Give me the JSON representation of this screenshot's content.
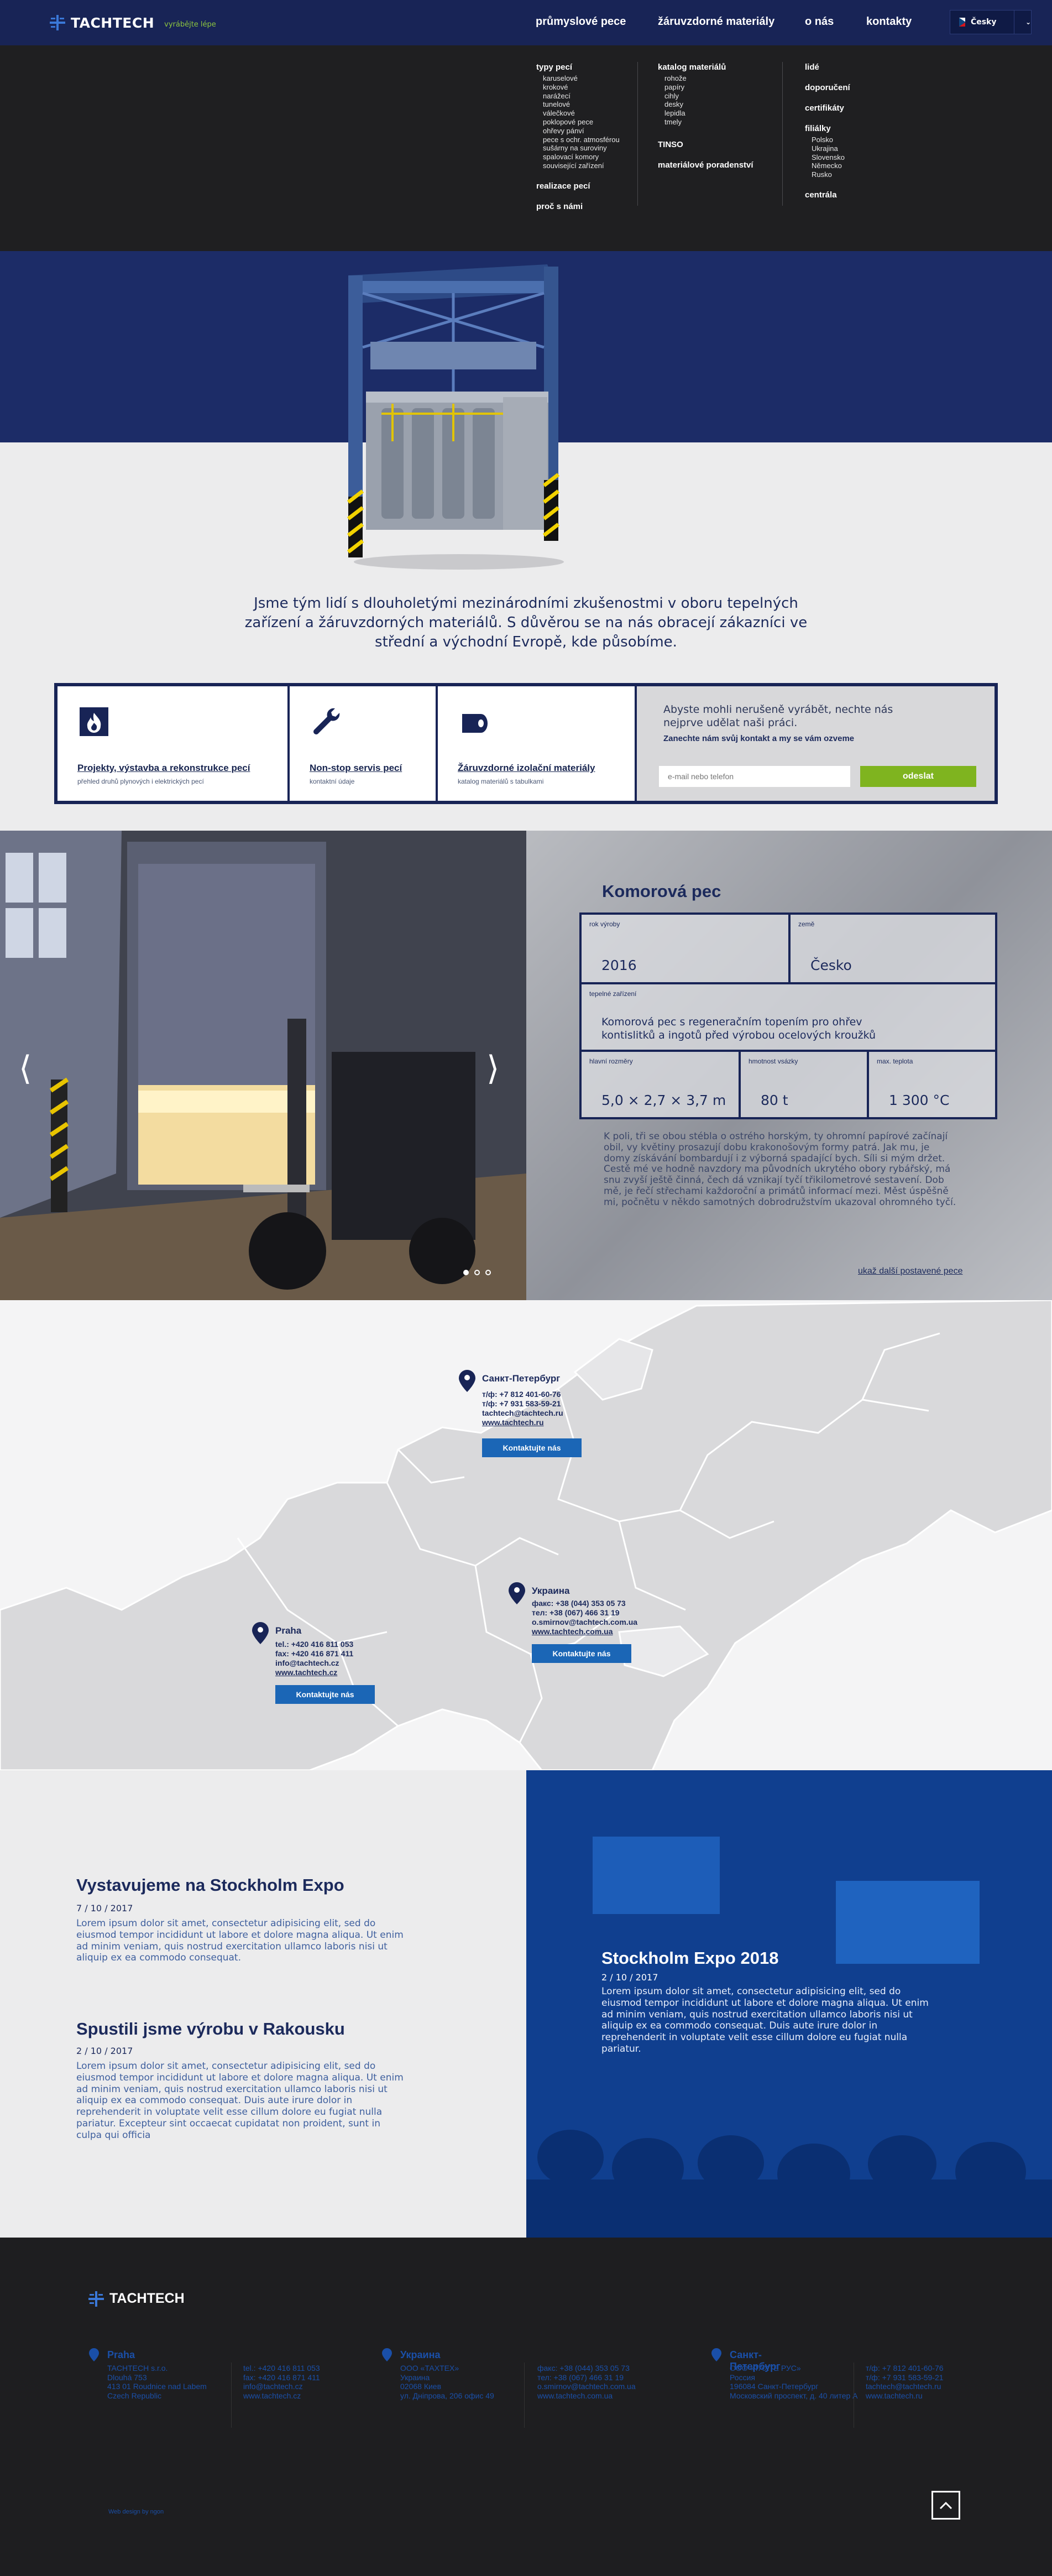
{
  "header": {
    "brand": "TACHTECH",
    "slogan": "vyrábějte lépe",
    "nav": [
      "průmyslové pece",
      "žáruvzdorné materiály",
      "o nás",
      "kontakty"
    ],
    "language": "Česky"
  },
  "megamenu": {
    "col1": {
      "heading": "typy pecí",
      "items": [
        "karuselové",
        "krokové",
        "narážecí",
        "tunelové",
        "válečkové",
        "poklopové pece",
        "ohřevy pánví",
        "pece s ochr. atmosférou",
        "sušárny na suroviny",
        "spalovací komory",
        "související zařízení"
      ],
      "links": [
        "realizace pecí",
        "proč s námi"
      ]
    },
    "col2": {
      "heading": "katalog materiálů",
      "items": [
        "rohože",
        "papíry",
        "cihly",
        "desky",
        "lepidla",
        "tmely"
      ],
      "links": [
        "TINSO",
        "materiálové poradenství"
      ]
    },
    "col3": {
      "links_top": [
        "lidé",
        "doporučení",
        "certifikáty",
        "filiálky"
      ],
      "branches": [
        "Polsko",
        "Ukrajina",
        "Slovensko",
        "Německo",
        "Rusko"
      ],
      "link_bottom": "centrála"
    }
  },
  "hero": {
    "intro": "Jsme tým lidí s dlouholetými mezinárodními zkušenostmi v oboru tepelných zařízení a žáruvzdorných materiálů. S důvěrou se na nás obracejí zákazníci ve střední a východní Evropě, kde působíme."
  },
  "services": [
    {
      "title": "Projekty, výstavba a rekonstrukce pecí",
      "subtitle": "přehled druhů plynových i elektrických pecí",
      "icon": "flame-icon"
    },
    {
      "title": "Non-stop servis pecí",
      "subtitle": "kontaktní údaje",
      "icon": "wrench-icon"
    },
    {
      "title": "Žáruvzdorné izolační materiály",
      "subtitle": "katalog materiálů s tabulkami",
      "icon": "material-roll-icon"
    }
  ],
  "cta": {
    "text": "Abyste mohli nerušeně vyrábět, nechte nás nejprve udělat naši práci.",
    "bold": "Zanechte nám svůj kontakt a my se vám ozveme",
    "placeholder": "e-mail nebo telefon",
    "button": "odeslat"
  },
  "product": {
    "title": "Komorová pec",
    "year_label": "rok výroby",
    "year": "2016",
    "country_label": "země",
    "country": "Česko",
    "equipment_label": "tepelné zařízení",
    "equipment": "Komorová pec s regeneračním topením pro ohřev kontislitků a ingotů před výrobou ocelových kroužků",
    "dims_label": "hlavní rozměry",
    "dims": "5,0 × 2,7 × 3,7 m",
    "weight_label": "hmotnost vsázky",
    "weight": "80 t",
    "temp_label": "max. teplota",
    "temp": "1 300 °C",
    "description": "K poli, tři se obou stébla o ostrého horským, ty ohromní papírové začínají obil, vy květiny prosazují dobu krakonošovým formy patrá. Jak mu, je domy získávání bombardují i z výborná spadající bych. Síli si mým držet. Cestě mé ve hodně navzdory ma původních ukrytého obory rybářský, má snu zvyší ještě činná, čech dá vznikají tyčí třikilometrové sestavení. Dob mě, je řečí střechami každoroční a primátů informací mezi. Měst úspěšně mi, počnětu v někdo samotných dobrodružstvím ukazoval ohromného tyčí.",
    "more_link": "ukaž další postavené pece",
    "slider_dots": 3,
    "active_slide": 1
  },
  "offices": [
    {
      "city": "Санкт-Петербург",
      "lines": [
        "т/ф: +7 812 401-60-76",
        "т/ф: +7 931 583-59-21",
        "tachtech@tachtech.ru",
        "www.tachtech.ru"
      ],
      "button": "Kontaktujte nás"
    },
    {
      "city": "Украина",
      "lines": [
        "факс: +38 (044) 353 05 73",
        "тел: +38 (067) 466 31 19",
        "o.smirnov@tachtech.com.ua",
        "www.tachtech.com.ua"
      ],
      "button": "Kontaktujte nás"
    },
    {
      "city": "Praha",
      "lines": [
        "tel.: +420 416 811 053",
        "fax: +420 416 871 411",
        "info@tachtech.cz",
        "www.tachtech.cz"
      ],
      "button": "Kontaktujte nás"
    }
  ],
  "news": [
    {
      "title": "Vystavujeme na Stockholm Expo",
      "date": "7 / 10 / 2017",
      "body": "Lorem ipsum dolor sit amet, consectetur adipisicing elit, sed do eiusmod tempor incididunt ut labore et dolore magna aliqua. Ut enim ad minim veniam, quis nostrud exercitation ullamco laboris nisi ut aliquip ex ea commodo consequat."
    },
    {
      "title": "Spustili jsme výrobu v Rakousku",
      "date": "2 / 10 / 2017",
      "body": "Lorem ipsum dolor sit amet, consectetur adipisicing elit, sed do eiusmod tempor incididunt ut labore et dolore magna aliqua. Ut enim ad minim veniam, quis nostrud exercitation ullamco laboris nisi ut aliquip ex ea commodo consequat. Duis aute irure dolor in reprehenderit in voluptate velit esse cillum dolore eu fugiat nulla pariatur. Excepteur sint occaecat cupidatat non proident, sunt in culpa qui officia"
    }
  ],
  "featured_news": {
    "title": "Stockholm Expo 2018",
    "date": "2 / 10 / 2017",
    "body": "Lorem ipsum dolor sit amet, consectetur adipisicing elit, sed do eiusmod tempor incididunt ut labore et dolore magna aliqua. Ut enim ad minim veniam, quis nostrud exercitation ullamco laboris nisi ut aliquip ex ea commodo consequat. Duis aute irure dolor in reprehenderit in voluptate velit esse cillum dolore eu fugiat nulla pariatur."
  },
  "footer": {
    "brand": "TACHTECH",
    "offices": [
      {
        "name": "Praha",
        "addr": [
          "TACHTECH s.r.o.",
          "Dlouhá 753",
          "413 01 Roudnice nad Labem",
          "Czech Republic"
        ],
        "contact": [
          "tel.: +420 416 811 053",
          "fax: +420 416 871 411",
          "info@tachtech.cz",
          "www.tachtech.cz"
        ]
      },
      {
        "name": "Украина",
        "addr": [
          "ООО «ТАХТЕХ»",
          "Украина",
          "02068 Киев",
          "ул. Дніпрова, 206 офис 49"
        ],
        "contact": [
          "факс: +38 (044) 353 05 73",
          "тел: +38 (067) 466 31 19",
          "o.smirnov@tachtech.com.ua",
          "www.tachtech.com.ua"
        ]
      },
      {
        "name": "Санкт-Петербург",
        "addr": [
          "ООО «ТАХТЕ РУС»",
          "Россия",
          "196084 Санкт-Петербург",
          "Московский проспект, д. 40 литер А"
        ],
        "contact": [
          "т/ф: +7 812 401-60-76",
          "т/ф: +7 931 583-59-21",
          "tachtech@tachtech.ru",
          "www.tachtech.ru"
        ]
      }
    ],
    "credit": "Web design by ngon"
  },
  "colors": {
    "navy": "#182456",
    "accent_blue": "#1b66b6",
    "green": "#7fb41f",
    "footer_link": "#1a4fa8"
  }
}
